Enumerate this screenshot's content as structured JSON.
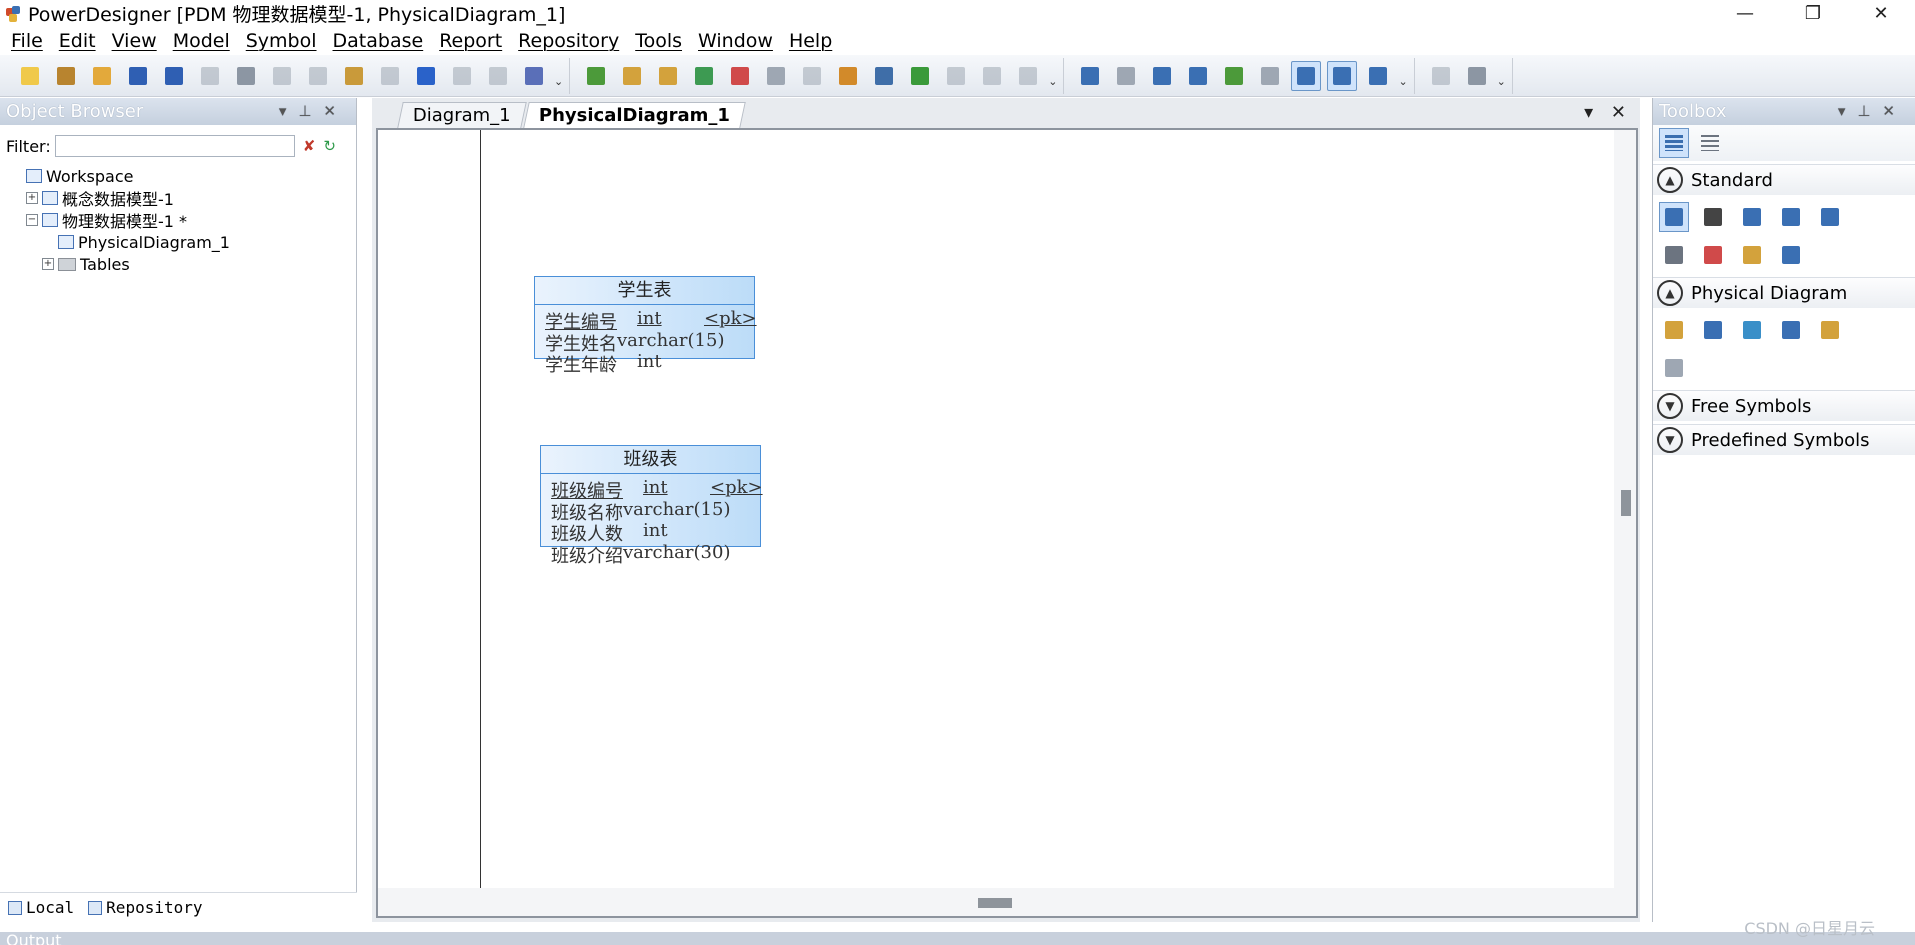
{
  "window": {
    "title": "PowerDesigner [PDM 物理数据模型-1, PhysicalDiagram_1]",
    "controls": [
      "—",
      "❐",
      "✕"
    ]
  },
  "menu": [
    "File",
    "Edit",
    "View",
    "Model",
    "Symbol",
    "Database",
    "Report",
    "Repository",
    "Tools",
    "Window",
    "Help"
  ],
  "toolbar": {
    "groups": [
      [
        {
          "name": "new-icon",
          "color": "#f0c94a"
        },
        {
          "name": "new-project-icon",
          "color": "#b8842f"
        },
        {
          "name": "open-icon",
          "color": "#e3a93b"
        },
        {
          "name": "save-icon",
          "color": "#2f5fb3"
        },
        {
          "name": "save-all-icon",
          "color": "#2f5fb3"
        },
        {
          "name": "print-preview-icon",
          "color": "#9ea7b3",
          "ghost": true
        },
        {
          "name": "print-icon",
          "color": "#8c96a3"
        },
        {
          "name": "cut-icon",
          "color": "#9ea7b3",
          "ghost": true
        },
        {
          "name": "copy-icon",
          "color": "#9ea7b3",
          "ghost": true
        },
        {
          "name": "paste-icon",
          "color": "#c99a3a"
        },
        {
          "name": "delete-icon",
          "color": "#9ea7b3",
          "ghost": true
        },
        {
          "name": "undo-icon",
          "color": "#2a62c9"
        },
        {
          "name": "redo-icon",
          "color": "#9ea7b3",
          "ghost": true
        },
        {
          "name": "properties-icon",
          "color": "#9ea7b3",
          "ghost": true
        },
        {
          "name": "check-model-icon",
          "color": "#5a6fb8"
        }
      ],
      [
        {
          "name": "browser-icon",
          "color": "#4c9a3a"
        },
        {
          "name": "result-list-icon",
          "color": "#d3a23c"
        },
        {
          "name": "find-icon",
          "color": "#d3a23c"
        },
        {
          "name": "refresh-icon",
          "color": "#3d9a52"
        },
        {
          "name": "check-icon",
          "color": "#d04a4a"
        },
        {
          "name": "shadow-icon",
          "color": "#9ea7b3"
        },
        {
          "name": "group-icon",
          "color": "#9ea7b3",
          "ghost": true
        },
        {
          "name": "brush-icon",
          "color": "#d28a2a"
        },
        {
          "name": "fill-icon",
          "color": "#3f6ea8"
        },
        {
          "name": "text-color-icon",
          "color": "#3a9a3a"
        },
        {
          "name": "align-icon",
          "color": "#9ea7b3",
          "ghost": true
        },
        {
          "name": "back-icon",
          "color": "#9ea7b3",
          "ghost": true
        },
        {
          "name": "forward-icon",
          "color": "#9ea7b3",
          "ghost": true
        }
      ],
      [
        {
          "name": "layout-icon",
          "color": "#3a6fb3"
        },
        {
          "name": "grid-icon",
          "color": "#9ea7b3"
        },
        {
          "name": "page-icon",
          "color": "#3a6fb3"
        },
        {
          "name": "multi-page-icon",
          "color": "#3a6fb3"
        },
        {
          "name": "color-map-icon",
          "color": "#4c9a3a"
        },
        {
          "name": "outline-icon",
          "color": "#9ea7b3"
        },
        {
          "name": "zoom-page-icon",
          "color": "#3a6fb3",
          "active": true
        },
        {
          "name": "comment-icon",
          "color": "#3a6fb3",
          "active": true
        },
        {
          "name": "list-view-icon",
          "color": "#3a6fb3"
        }
      ],
      [
        {
          "name": "preview-icon",
          "color": "#9ea7b3",
          "ghost": true
        },
        {
          "name": "print-setup-icon",
          "color": "#8c96a3"
        }
      ]
    ]
  },
  "objectBrowser": {
    "title": "Object Browser",
    "filterLabel": "Filter:",
    "filterValue": "",
    "tree": [
      {
        "label": "Workspace",
        "level": 0,
        "expander": "",
        "icon": "workspace"
      },
      {
        "label": "概念数据模型-1",
        "level": 1,
        "expander": "+",
        "icon": "model"
      },
      {
        "label": "物理数据模型-1 *",
        "level": 1,
        "expander": "−",
        "icon": "model"
      },
      {
        "label": "PhysicalDiagram_1",
        "level": 2,
        "expander": "",
        "icon": "diagram"
      },
      {
        "label": "Tables",
        "level": 2,
        "expander": "+",
        "icon": "folder"
      }
    ],
    "tabs": [
      "Local",
      "Repository"
    ]
  },
  "document": {
    "tabs": [
      {
        "label": "Diagram_1",
        "active": false
      },
      {
        "label": "PhysicalDiagram_1",
        "active": true
      }
    ],
    "controls": "▾ ✕"
  },
  "entities": [
    {
      "title": "学生表",
      "rows": [
        {
          "name": "学生编号",
          "type": "int",
          "key": "<pk>"
        },
        {
          "name": "学生姓名",
          "type": "varchar(15)",
          "key": ""
        },
        {
          "name": "学生年龄",
          "type": "int",
          "key": ""
        }
      ]
    },
    {
      "title": "班级表",
      "rows": [
        {
          "name": "班级编号",
          "type": "int",
          "key": "<pk>"
        },
        {
          "name": "班级名称",
          "type": "varchar(15)",
          "key": ""
        },
        {
          "name": "班级人数",
          "type": "int",
          "key": ""
        },
        {
          "name": "班级介绍",
          "type": "varchar(30)",
          "key": ""
        }
      ]
    }
  ],
  "toolbox": {
    "title": "Toolbox",
    "sections": [
      {
        "label": "Standard",
        "expanded": true,
        "tools": [
          {
            "name": "pointer-icon",
            "color": "#3a6fb3",
            "active": true
          },
          {
            "name": "grabber-icon",
            "color": "#444"
          },
          {
            "name": "zoom-in-icon",
            "color": "#3a6fb3"
          },
          {
            "name": "zoom-out-icon",
            "color": "#3a6fb3"
          },
          {
            "name": "open-package-icon",
            "color": "#3a6fb3"
          },
          {
            "name": "properties-tool-icon",
            "color": "#6c7480"
          },
          {
            "name": "delete-tool-icon",
            "color": "#d04a4a"
          },
          {
            "name": "note-icon",
            "color": "#d3a23c"
          },
          {
            "name": "link-icon",
            "color": "#3a6fb3"
          }
        ]
      },
      {
        "label": "Physical Diagram",
        "expanded": true,
        "tools": [
          {
            "name": "package-icon",
            "color": "#d3a23c"
          },
          {
            "name": "table-icon",
            "color": "#3a6fb3"
          },
          {
            "name": "view-icon",
            "color": "#3a8fc8"
          },
          {
            "name": "reference-icon",
            "color": "#3a6fb3"
          },
          {
            "name": "procedure-icon",
            "color": "#d3a23c"
          },
          {
            "name": "file-icon",
            "color": "#9ea7b3"
          }
        ]
      },
      {
        "label": "Free Symbols",
        "expanded": false,
        "tools": []
      },
      {
        "label": "Predefined Symbols",
        "expanded": false,
        "tools": []
      }
    ]
  },
  "output": {
    "title": "Output"
  },
  "watermark": "CSDN @日星月云"
}
